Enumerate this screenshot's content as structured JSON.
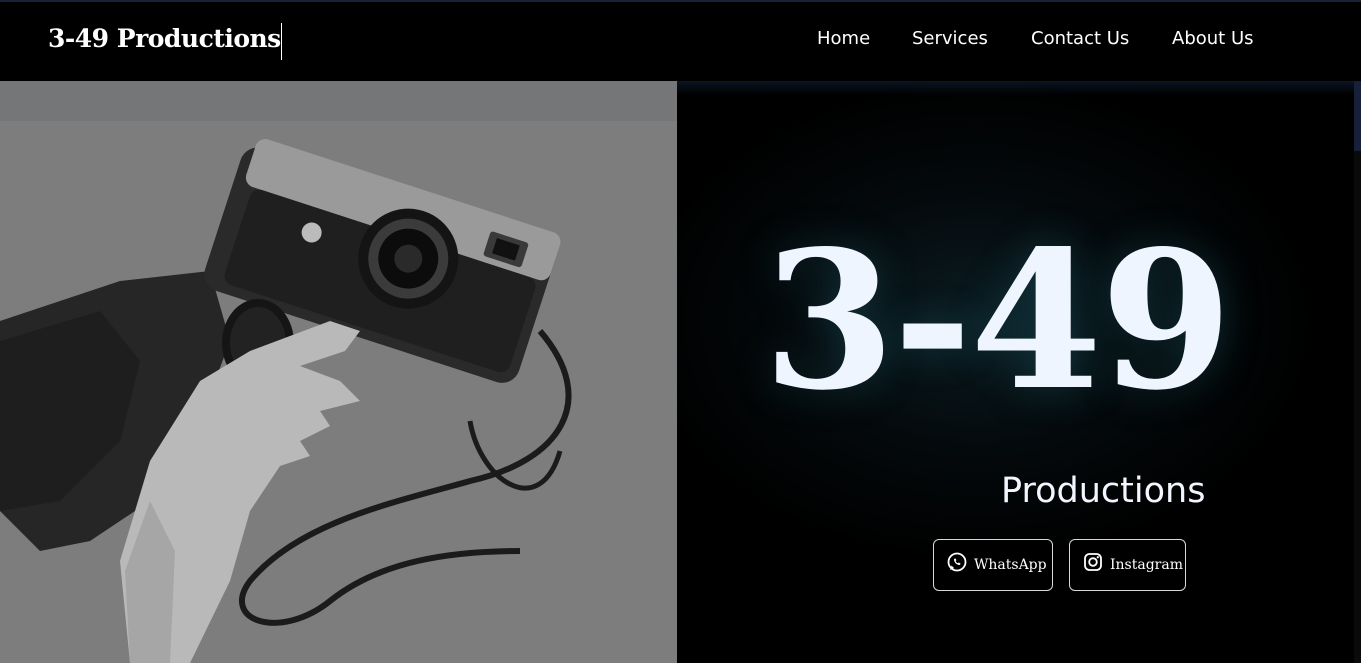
{
  "navbar": {
    "brand": "3-49 Productions",
    "items": [
      {
        "label": "Home"
      },
      {
        "label": "Services"
      },
      {
        "label": "Contact Us"
      },
      {
        "label": "About Us"
      }
    ]
  },
  "hero": {
    "title": "3-49",
    "subtitle": "Productions",
    "buttons": [
      {
        "label": "WhatsApp",
        "icon": "whatsapp-icon"
      },
      {
        "label": "Instagram",
        "icon": "instagram-icon"
      }
    ]
  },
  "colors": {
    "background": "#000000",
    "text": "#ffffff",
    "hero_title": "#eef5ff"
  }
}
